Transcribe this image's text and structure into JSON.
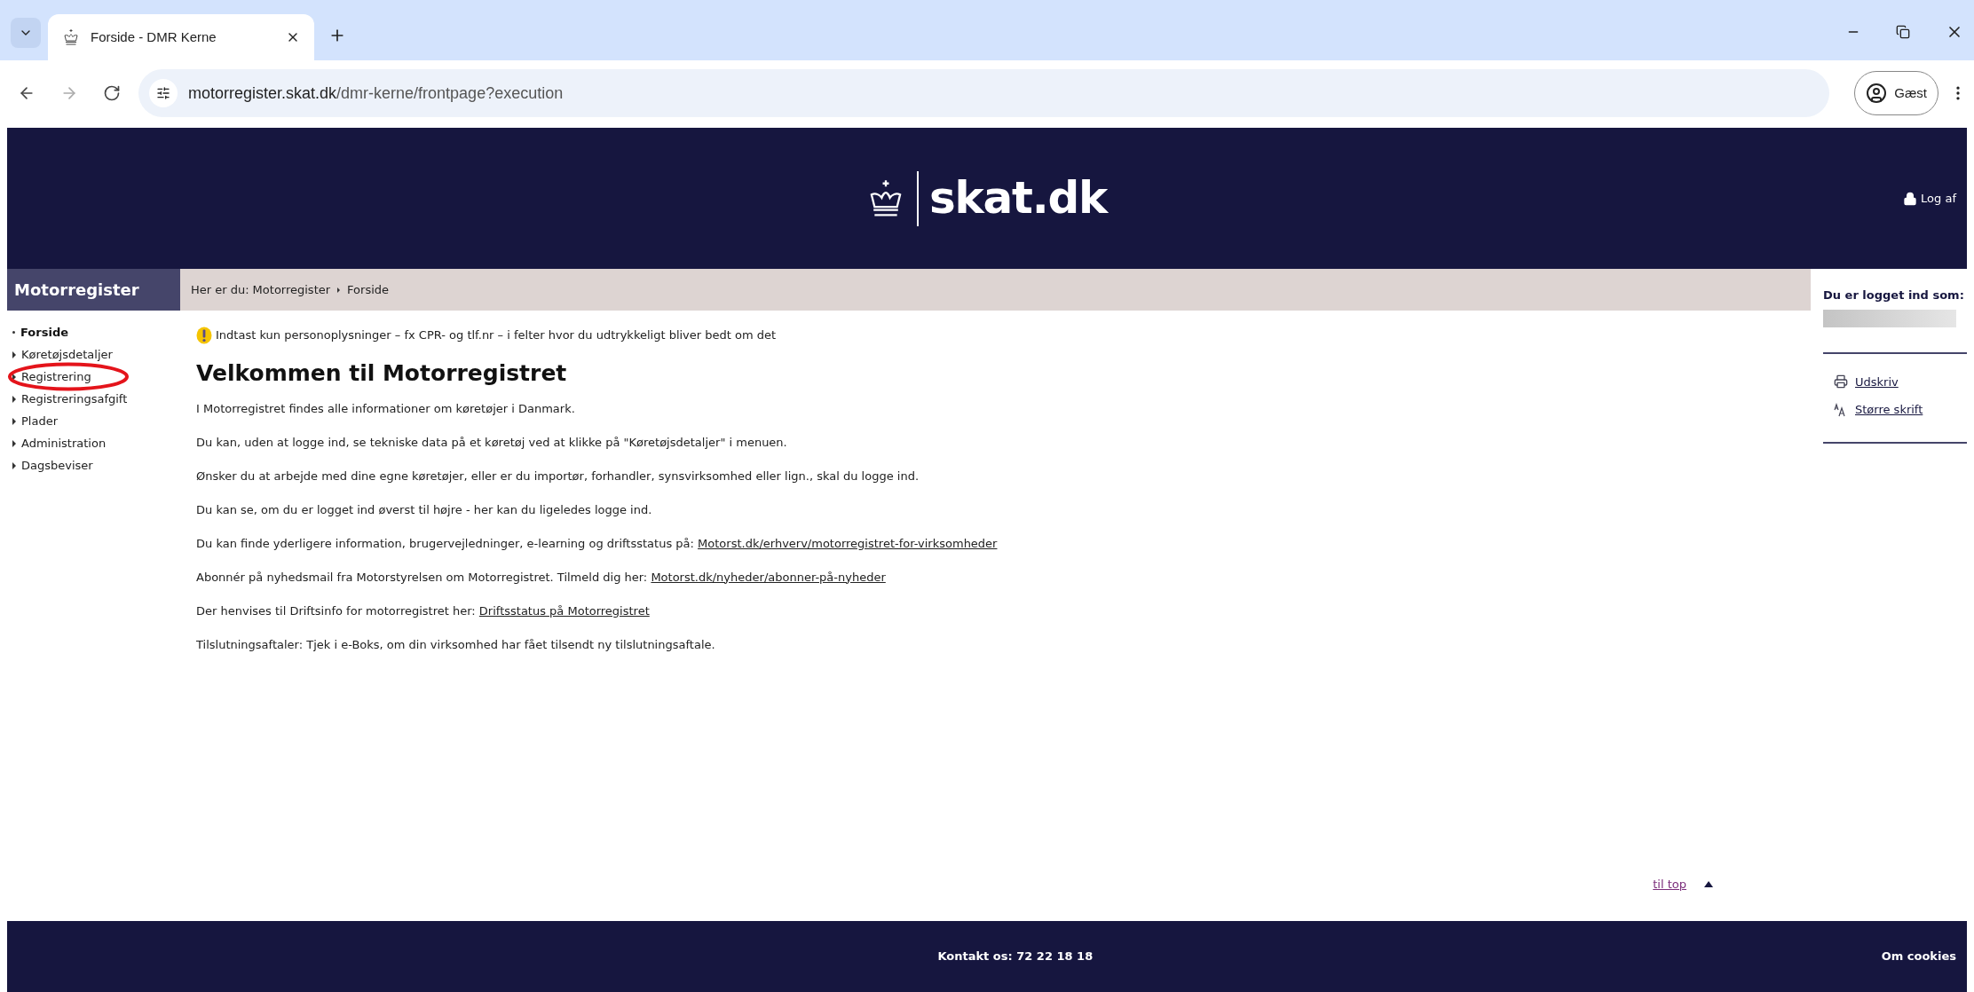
{
  "browser": {
    "tab_title": "Forside - DMR Kerne",
    "url_host": "motorregister.skat.dk",
    "url_path": "/dmr-kerne/frontpage?execution",
    "profile": "Gæst"
  },
  "header": {
    "logo_text": "skat.dk",
    "logout": "Log af"
  },
  "sidebar": {
    "title": "Motorregister",
    "items": [
      {
        "label": "Forside",
        "selected": true,
        "highlighted": false
      },
      {
        "label": "Køretøjsdetaljer",
        "selected": false,
        "highlighted": false
      },
      {
        "label": "Registrering",
        "selected": false,
        "highlighted": true
      },
      {
        "label": "Registreringsafgift",
        "selected": false,
        "highlighted": false
      },
      {
        "label": "Plader",
        "selected": false,
        "highlighted": false
      },
      {
        "label": "Administration",
        "selected": false,
        "highlighted": false
      },
      {
        "label": "Dagsbeviser",
        "selected": false,
        "highlighted": false
      }
    ]
  },
  "breadcrumb": {
    "prefix": "Her er du:",
    "items": [
      "Motorregister",
      "Forside"
    ]
  },
  "notice": "Indtast kun personoplysninger – fx CPR- og tlf.nr – i felter hvor du udtrykkeligt bliver bedt om det",
  "heading": "Velkommen til Motorregistret",
  "paragraphs": [
    {
      "text": "I Motorregistret findes alle informationer om køretøjer i Danmark."
    },
    {
      "text": "Du kan, uden at logge ind, se tekniske data på et køretøj ved at klikke på \"Køretøjsdetaljer\" i menuen."
    },
    {
      "text": "Ønsker du at arbejde med dine egne køretøjer, eller er du importør, forhandler, synsvirksomhed eller lign., skal du logge ind."
    },
    {
      "text": "Du kan se, om du er logget ind øverst til højre - her kan du ligeledes logge ind."
    },
    {
      "text": "Du kan finde yderligere information, brugervejledninger, e-learning og driftsstatus på:",
      "link": "Motorst.dk/erhverv/motorregistret-for-virksomheder"
    },
    {
      "text": "Abonnér på nyhedsmail fra Motorstyrelsen om Motorregistret. Tilmeld dig her:",
      "link": "Motorst.dk/nyheder/abonner-på-nyheder"
    },
    {
      "text": "Der henvises til Driftsinfo for motorregistret her:",
      "link": "Driftsstatus på Motorregistret"
    },
    {
      "text": "Tilslutningsaftaler: Tjek i e-Boks, om din virksomhed har fået tilsendt ny tilslutningsaftale."
    }
  ],
  "right_panel": {
    "title": "Du er logget ind som:",
    "links": [
      "Udskriv",
      "Større skrift"
    ]
  },
  "to_top": "til top",
  "footer": {
    "contact": "Kontakt os: 72 22 18 18",
    "cookies": "Om cookies"
  }
}
